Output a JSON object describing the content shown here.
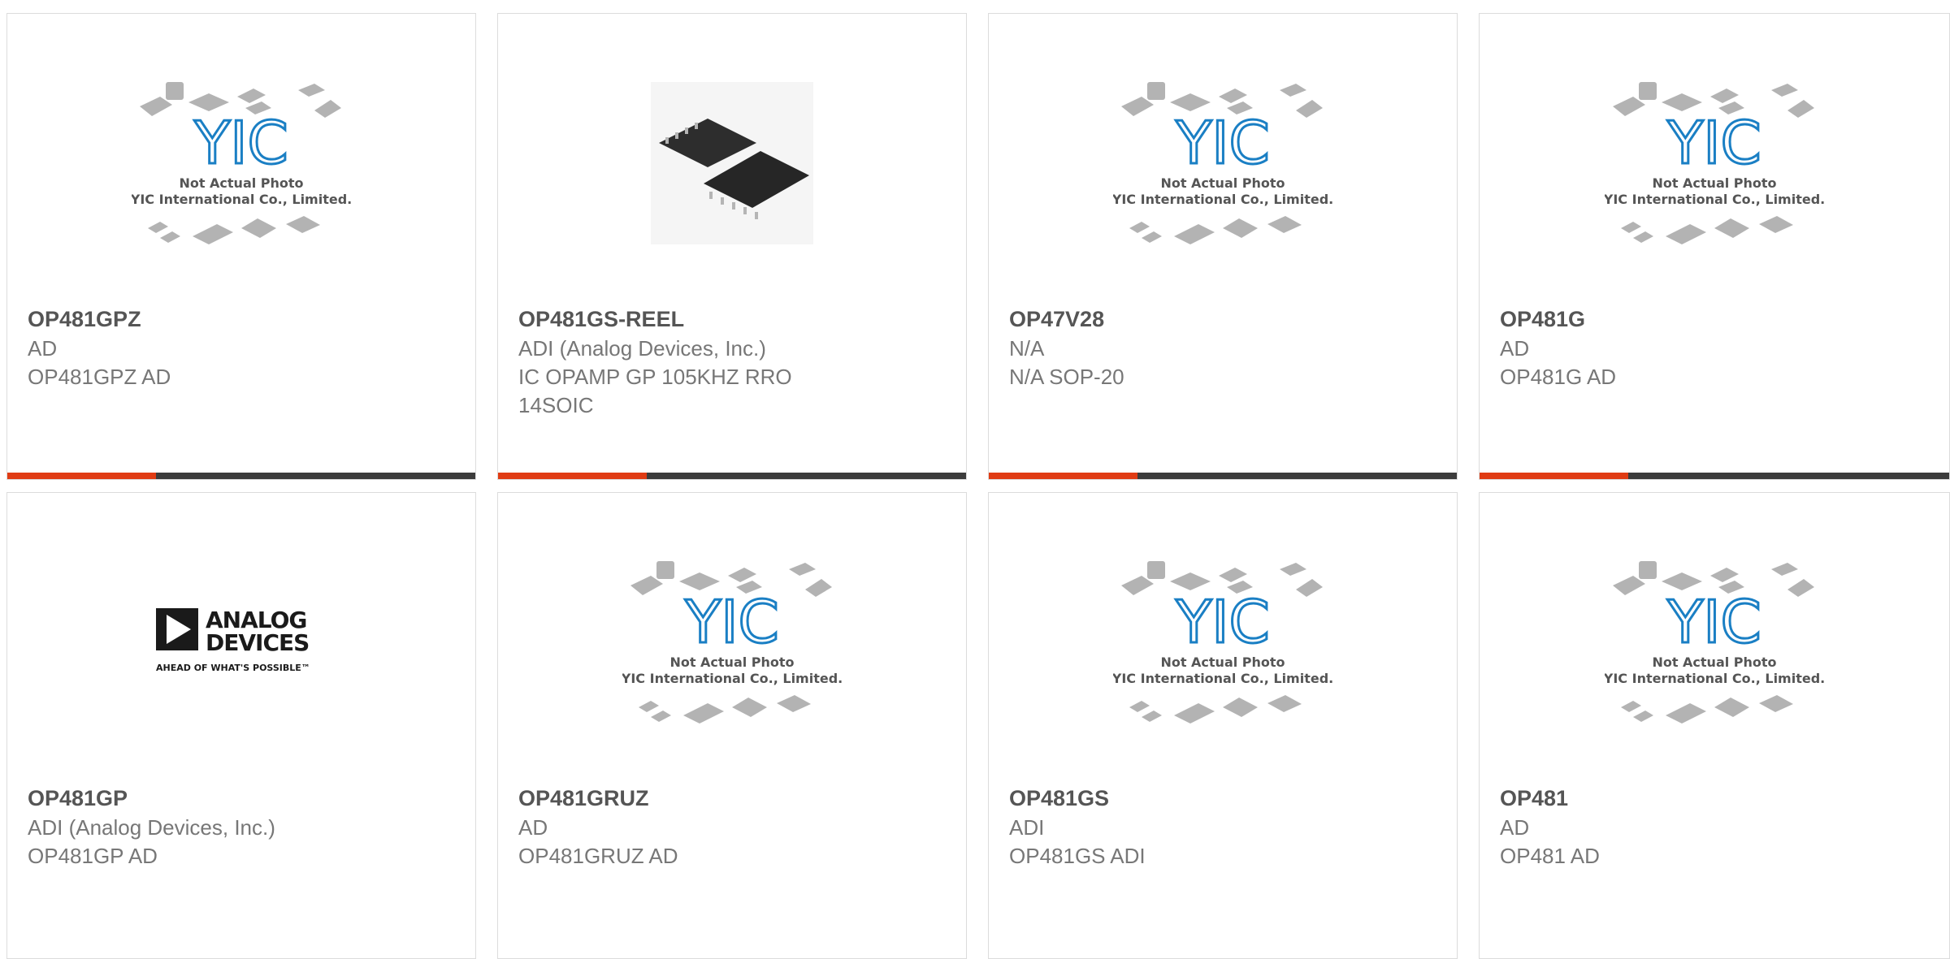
{
  "placeholder": {
    "logo_text": "YIC",
    "line1": "Not Actual Photo",
    "line2": "YIC International Co., Limited."
  },
  "adi_logo": {
    "line1": "ANALOG",
    "line2": "DEVICES",
    "tagline": "AHEAD OF WHAT'S POSSIBLE™"
  },
  "colors": {
    "accent": "#e03c14",
    "bar": "#3c3c3c",
    "logo_blue": "#1a7fc4"
  },
  "cards": [
    {
      "part": "OP481GPZ",
      "mfr": "AD",
      "desc": "OP481GPZ AD",
      "image": "placeholder"
    },
    {
      "part": "OP481GS-REEL",
      "mfr": "ADI (Analog Devices, Inc.)",
      "desc": "IC OPAMP GP 105KHZ RRO 14SOIC",
      "image": "soic-photo"
    },
    {
      "part": "OP47V28",
      "mfr": "N/A",
      "desc": "N/A SOP-20",
      "image": "placeholder"
    },
    {
      "part": "OP481G",
      "mfr": "AD",
      "desc": "OP481G AD",
      "image": "placeholder"
    },
    {
      "part": "OP481GP",
      "mfr": "ADI (Analog Devices, Inc.)",
      "desc": "OP481GP AD",
      "image": "adi-logo"
    },
    {
      "part": "OP481GRUZ",
      "mfr": "AD",
      "desc": "OP481GRUZ AD",
      "image": "placeholder"
    },
    {
      "part": "OP481GS",
      "mfr": "ADI",
      "desc": "OP481GS ADI",
      "image": "placeholder"
    },
    {
      "part": "OP481",
      "mfr": "AD",
      "desc": "OP481 AD",
      "image": "placeholder"
    }
  ]
}
